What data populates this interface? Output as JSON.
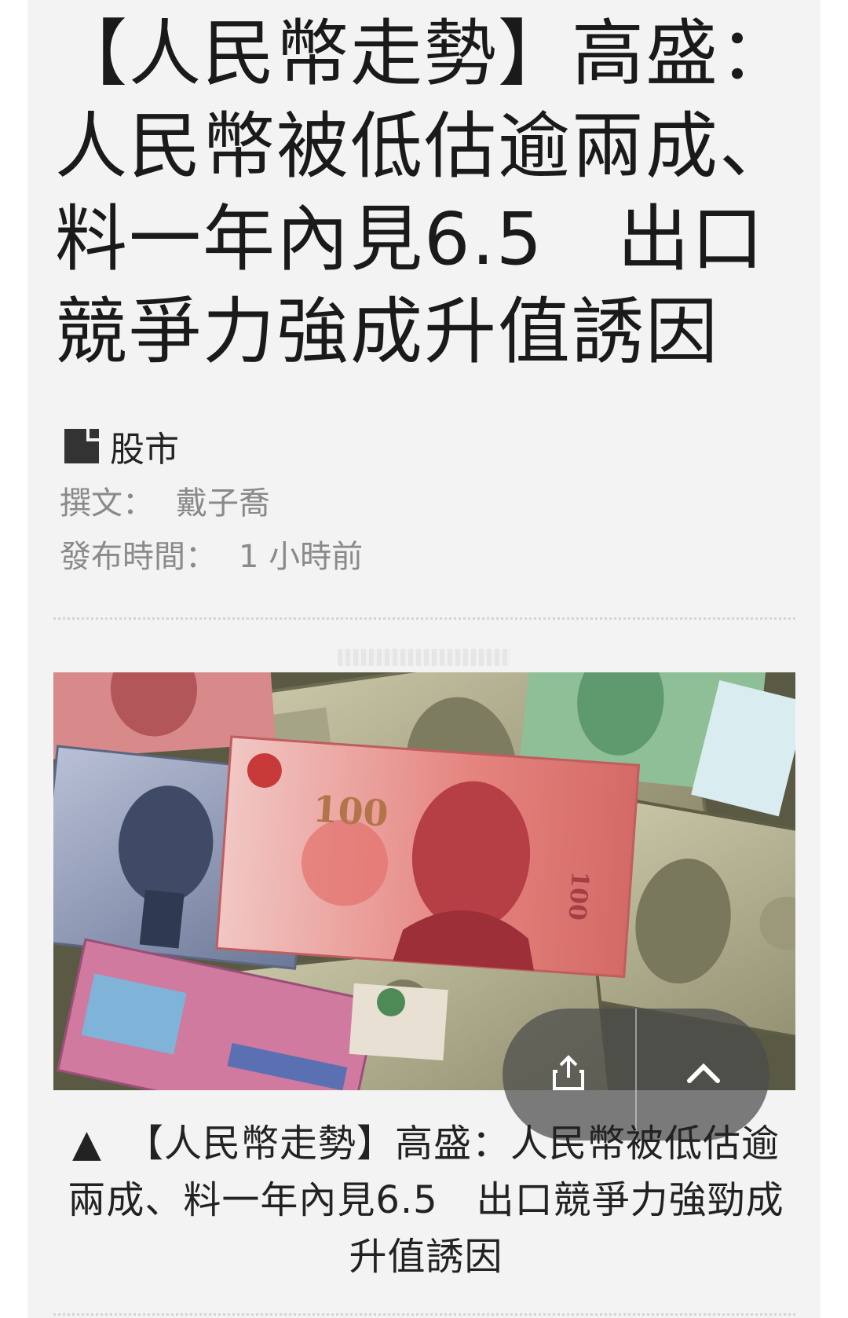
{
  "article": {
    "title": "【人民幣走勢】高盛：人民幣被低估逾兩成、料一年內見6.5　出口競爭力強成升值誘因",
    "category": "股市",
    "author_label": "撰文：",
    "author_name": "戴子喬",
    "published_label": "發布時間：",
    "published_value": "1 小時前"
  },
  "image": {
    "caption_marker": "▲",
    "caption": "【人民幣走勢】高盛：人民幣被低估逾兩成、料一年內見6.5　出口競爭力強勁成升值誘因",
    "banknote_value": "100"
  },
  "controls": {
    "share_icon": "share-icon",
    "top_icon": "chevron-up-icon"
  },
  "colors": {
    "background": "#f3f3f3",
    "title": "#1a1a1a",
    "meta": "#8a8a8a",
    "control": "#4b4b4b"
  }
}
